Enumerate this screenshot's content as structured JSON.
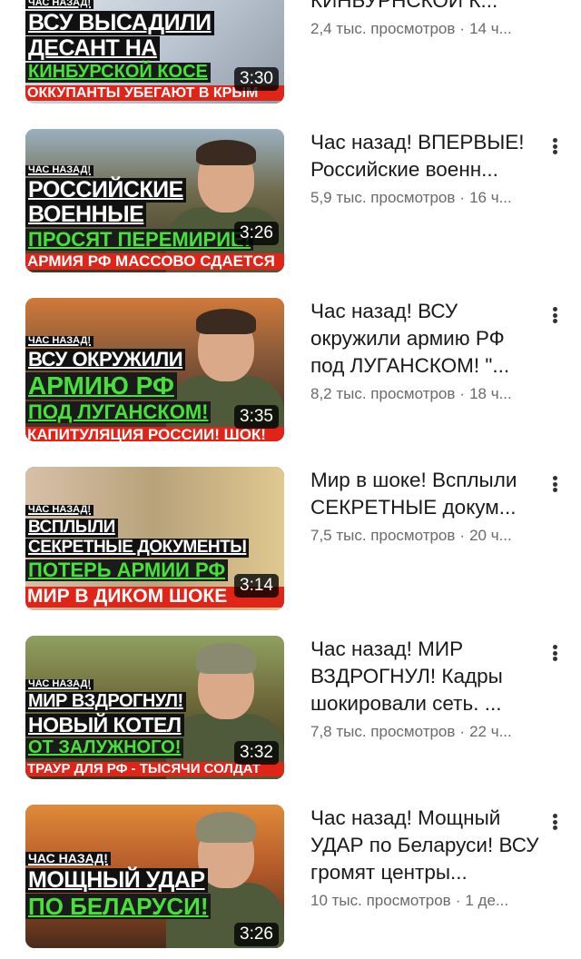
{
  "feed": {
    "items": [
      {
        "title": "высадили ДЕСАНТ на КИНБУРНСКОЙ К...",
        "views": "2,4 тыс. просмотров",
        "age": "14 ч...",
        "duration": "3:30",
        "thumb": {
          "tag": "ЧАС НАЗАД!",
          "line1": "ВСУ ВЫСАДИЛИ",
          "line2": "ДЕСАНТ НА",
          "line3": "КИНБУРСКОЙ КОСЕ",
          "banner": "ОККУПАНТЫ УБЕГАЮТ В КРЫМ",
          "bg_color": "#cfd7e0"
        }
      },
      {
        "title": "Час назад! ВПЕРВЫЕ! Российские военн...",
        "views": "5,9 тыс. просмотров",
        "age": "16 ч...",
        "duration": "3:26",
        "thumb": {
          "tag": "ЧАС НАЗАД!",
          "line1": "РОССИЙСКИЕ",
          "line2": "ВОЕННЫЕ",
          "line3": "ПРОСЯТ ПЕРЕМИРИЕ!",
          "banner": "АРМИЯ РФ МАССОВО СДАЕТСЯ",
          "bg_color": "#7a6a4a"
        }
      },
      {
        "title": "Час назад! ВСУ окружили армию РФ под ЛУГАНСКОМ! \"...",
        "views": "8,2 тыс. просмотров",
        "age": "18 ч...",
        "duration": "3:35",
        "thumb": {
          "tag": "ЧАС НАЗАД!",
          "line1": "ВСУ ОКРУЖИЛИ",
          "line2": "АРМИЮ РФ",
          "line3": "ПОД ЛУГАНСКОМ!",
          "banner": "КАПИТУЛЯЦИЯ РОССИИ! ШОК!",
          "bg_color": "#8a5a3a"
        }
      },
      {
        "title": "Мир в шоке! Всплыли СЕКРЕТНЫЕ докум...",
        "views": "7,5 тыс. просмотров",
        "age": "20 ч...",
        "duration": "3:14",
        "thumb": {
          "tag": "ЧАС НАЗАД!",
          "line1": "ВСПЛЫЛИ",
          "line2": "СЕКРЕТНЫЕ ДОКУМЕНТЫ",
          "line3": "ПОТЕРЬ АРМИИ РФ",
          "banner": "МИР В ДИКОМ ШОКЕ",
          "bg_color": "#b8a27a"
        }
      },
      {
        "title": "Час назад! МИР ВЗДРОГНУЛ! Кадры шокировали сеть. ...",
        "views": "7,8 тыс. просмотров",
        "age": "22 ч...",
        "duration": "3:32",
        "thumb": {
          "tag": "ЧАС НАЗАД!",
          "line1": "МИР ВЗДРОГНУЛ!",
          "line2": "НОВЫЙ КОТЕЛ",
          "line3": "ОТ ЗАЛУЖНОГО!",
          "banner": "ТРАУР ДЛЯ РФ - ТЫСЯЧИ СОЛДАТ",
          "bg_color": "#6f6a3a"
        }
      },
      {
        "title": "Час назад! Мощный УДАР по Беларуси! ВСУ громят центры...",
        "views": "10 тыс. просмотров",
        "age": "1 де...",
        "duration": "3:26",
        "thumb": {
          "tag": "ЧАС НАЗАД!",
          "line1": "МОЩНЫЙ УДАР",
          "line2": "ПО БЕЛАРУСИ!",
          "line3": "",
          "banner": "",
          "bg_color": "#b35a2a"
        }
      }
    ]
  },
  "icons": {
    "more": "more-vert-icon"
  },
  "colors": {
    "caption_green": "#46e23a",
    "banner_red": "#e12418",
    "subtitle_gray": "#6a6a6a",
    "title_text": "#1a1a1a"
  }
}
